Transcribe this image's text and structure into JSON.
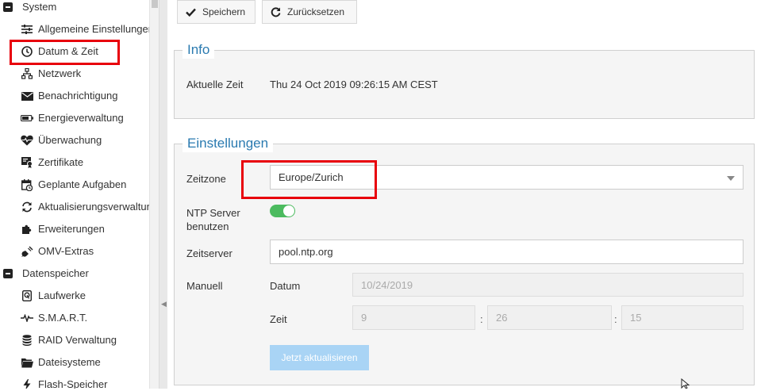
{
  "sidebar": {
    "groups": [
      {
        "label": "System"
      },
      {
        "label": "Datenspeicher"
      }
    ],
    "system_items": [
      {
        "label": "Allgemeine Einstellungen",
        "icon": "sliders-icon"
      },
      {
        "label": "Datum & Zeit",
        "icon": "clock-icon"
      },
      {
        "label": "Netzwerk",
        "icon": "network-icon"
      },
      {
        "label": "Benachrichtigung",
        "icon": "envelope-icon"
      },
      {
        "label": "Energieverwaltung",
        "icon": "battery-icon"
      },
      {
        "label": "Überwachung",
        "icon": "heartbeat-icon"
      },
      {
        "label": "Zertifikate",
        "icon": "certificate-icon"
      },
      {
        "label": "Geplante Aufgaben",
        "icon": "calendar-clock-icon"
      },
      {
        "label": "Aktualisierungsverwaltung",
        "icon": "refresh-icon"
      },
      {
        "label": "Erweiterungen",
        "icon": "puzzle-icon"
      },
      {
        "label": "OMV-Extras",
        "icon": "plug-icon"
      }
    ],
    "storage_items": [
      {
        "label": "Laufwerke",
        "icon": "disk-icon"
      },
      {
        "label": "S.M.A.R.T.",
        "icon": "pulse-icon"
      },
      {
        "label": "RAID Verwaltung",
        "icon": "database-icon"
      },
      {
        "label": "Dateisysteme",
        "icon": "folder-icon"
      },
      {
        "label": "Flash-Speicher",
        "icon": "flash-icon"
      }
    ]
  },
  "toolbar": {
    "save_label": "Speichern",
    "reset_label": "Zurücksetzen"
  },
  "info": {
    "legend": "Info",
    "current_time_label": "Aktuelle Zeit",
    "current_time_value": "Thu 24 Oct 2019 09:26:15 AM CEST"
  },
  "settings": {
    "legend": "Einstellungen",
    "timezone_label": "Zeitzone",
    "timezone_value": "Europe/Zurich",
    "ntp_label": "NTP Server benutzen",
    "ntp_enabled": true,
    "timeserver_label": "Zeitserver",
    "timeserver_value": "pool.ntp.org",
    "manual_label": "Manuell",
    "date_label": "Datum",
    "date_value": "10/24/2019",
    "time_label": "Zeit",
    "hour": "9",
    "minute": "26",
    "second": "15",
    "separator": ":",
    "update_now_label": "Jetzt aktualisieren"
  },
  "colors": {
    "accent": "#2a7ab0",
    "highlight": "#e8000b",
    "toggle_on": "#4cbb5f"
  }
}
